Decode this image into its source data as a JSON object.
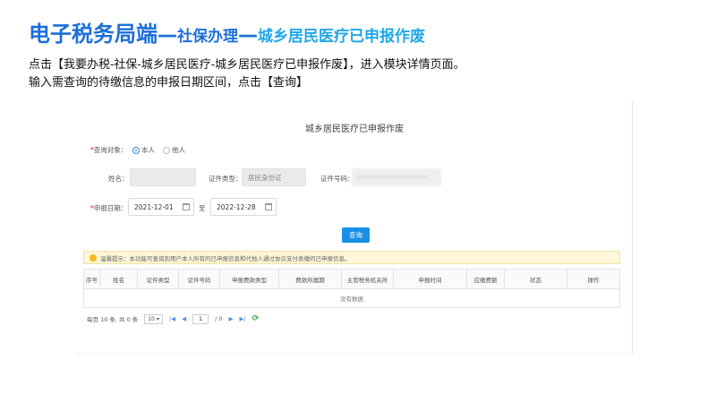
{
  "slide": {
    "title_main": "电子税务局端",
    "dash": "—",
    "title_sub": "社保办理",
    "title_last": "城乡居民医疗已申报作废",
    "instruction_line1": "点击【我要办税-社保-城乡居民医疗-城乡居民医疗已申报作废】，进入模块详情页面。",
    "instruction_line2": "输入需查询的待缴信息的申报日期区间，点击【查询】"
  },
  "form": {
    "title": "城乡居民医疗已申报作废",
    "required_mark": "*",
    "query_target_label": "查询对象：",
    "radio_self": "本人",
    "radio_other": "他人",
    "name_label": "姓名：",
    "cert_type_label": "证件类型：",
    "cert_type_value": "居民身份证",
    "cert_no_label": "证件号码：",
    "cert_no_value": "••••••••••••••••••",
    "date_label": "申报日期：",
    "date_from": "2021-12-01",
    "date_to_label": "至",
    "date_to": "2022-12-28",
    "query_button": "查询"
  },
  "tip": {
    "text": "温馨提示：本功能可查询到用户本人所有的已申报信息和代他人通过协议支付表缴的已申报信息。"
  },
  "table": {
    "columns": [
      "序号",
      "姓名",
      "证件类型",
      "证件号码",
      "申报费款类型",
      "费款所属期",
      "主管税务机关所",
      "申报时间",
      "应缴费额",
      "状态",
      "操作"
    ],
    "empty_text": "没有数据"
  },
  "pager": {
    "summary": "每页 10 条, 共 0 条",
    "page_size": "10",
    "current_page": "1",
    "total_pages": "/ 0"
  }
}
